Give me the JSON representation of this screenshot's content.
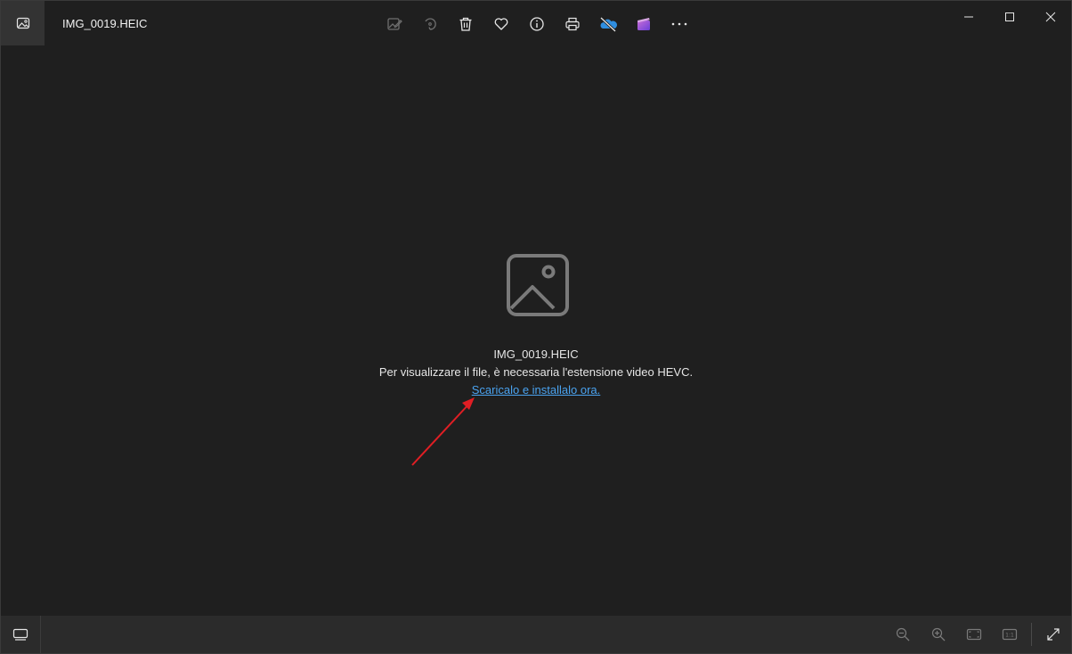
{
  "window": {
    "title": "IMG_0019.HEIC",
    "toolbar": [
      {
        "name": "edit-image-icon"
      },
      {
        "name": "rotate-icon"
      },
      {
        "name": "delete-icon"
      },
      {
        "name": "favorite-heart-icon"
      },
      {
        "name": "info-icon"
      },
      {
        "name": "print-icon"
      },
      {
        "name": "onedrive-offline-icon"
      },
      {
        "name": "video-editor-icon"
      },
      {
        "name": "more-options-icon"
      }
    ]
  },
  "content": {
    "file_name": "IMG_0019.HEIC",
    "message": "Per visualizzare il file, è necessaria l'estensione video HEVC.",
    "link_text": "Scaricalo e installalo ora."
  },
  "bottom_bar": {
    "right_buttons": [
      "zoom-out-icon",
      "zoom-in-icon",
      "fit-to-window-icon",
      "actual-size-icon",
      "fullscreen-icon"
    ],
    "actual_size_label": "1:1"
  },
  "colors": {
    "background": "#1f1f1f",
    "link": "#4aa3f0",
    "annotation_arrow": "#e01e24"
  }
}
